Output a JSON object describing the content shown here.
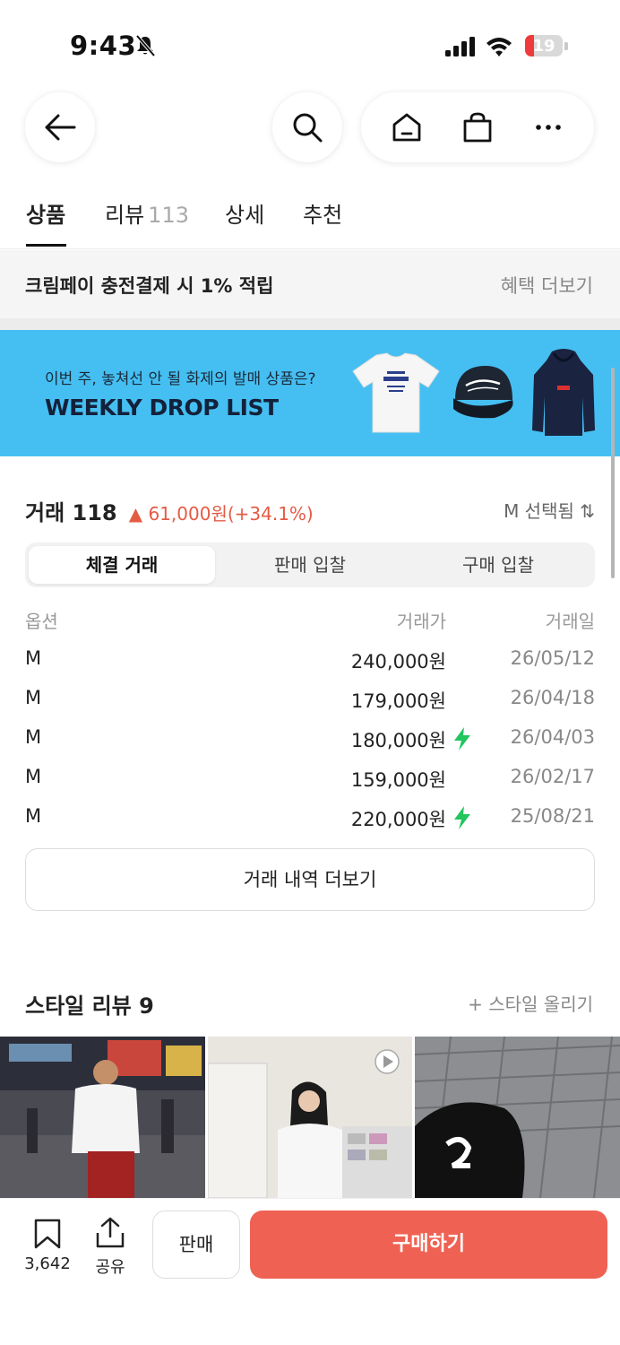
{
  "status_bar": {
    "time": "9:43",
    "battery": "19"
  },
  "tabs": [
    {
      "label": "상품"
    },
    {
      "label": "리뷰",
      "count": "113"
    },
    {
      "label": "상세"
    },
    {
      "label": "추천"
    }
  ],
  "benefit": {
    "text": "크림페이 충전결제 시 1% 적립",
    "more": "혜택 더보기"
  },
  "banner": {
    "subtitle": "이번 주, 놓쳐선 안 될 화제의 발매 상품은?",
    "title": "WEEKLY DROP LIST"
  },
  "trade": {
    "title": "거래 118",
    "change": "▲ 61,000원(+34.1%)",
    "size_selected": "M 선택됨 ⇅",
    "segments": [
      "체결 거래",
      "판매 입찰",
      "구매 입찰"
    ],
    "headers": {
      "option": "옵션",
      "price": "거래가",
      "date": "거래일"
    },
    "rows": [
      {
        "option": "M",
        "price": "240,000원",
        "date": "26/05/12",
        "fast": false
      },
      {
        "option": "M",
        "price": "179,000원",
        "date": "26/04/18",
        "fast": false
      },
      {
        "option": "M",
        "price": "180,000원",
        "date": "26/04/03",
        "fast": true
      },
      {
        "option": "M",
        "price": "159,000원",
        "date": "26/02/17",
        "fast": false
      },
      {
        "option": "M",
        "price": "220,000원",
        "date": "25/08/21",
        "fast": true
      }
    ],
    "more_label": "거래 내역 더보기"
  },
  "style_review": {
    "title": "스타일 리뷰 9",
    "add_label": "+ 스타일 올리기"
  },
  "bottom_bar": {
    "bookmark_count": "3,642",
    "share_label": "공유",
    "sell_label": "판매",
    "buy_label": "구매하기"
  },
  "colors": {
    "accent": "#ef6253",
    "banner_bg": "#45bff2",
    "up_red": "#e45b44",
    "fast_green": "#22c55e"
  }
}
